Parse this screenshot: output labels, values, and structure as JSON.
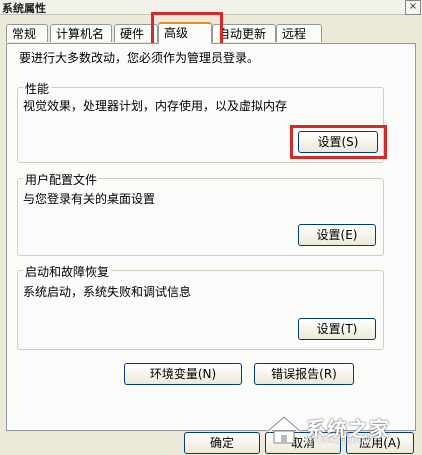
{
  "window": {
    "title": "系统属性",
    "close_glyph": "×"
  },
  "tabs": [
    {
      "label": "常规"
    },
    {
      "label": "计算机名"
    },
    {
      "label": "硬件"
    },
    {
      "label": "高级"
    },
    {
      "label": "自动更新"
    },
    {
      "label": "远程"
    }
  ],
  "notice": "要进行大多数改动，您必须作为管理员登录。",
  "performance": {
    "title": "性能",
    "desc": "视觉效果，处理器计划，内存使用，以及虚拟内存",
    "button": "设置(S)"
  },
  "profile": {
    "title": "用户配置文件",
    "desc": "与您登录有关的桌面设置",
    "button": "设置(E)"
  },
  "startup": {
    "title": "启动和故障恢复",
    "desc": "系统启动，系统失败和调试信息",
    "button": "设置(T)"
  },
  "bottom": {
    "env_button": "环境变量(N)",
    "error_button": "错误报告(R)"
  },
  "footer": {
    "ok": "确定",
    "cancel": "取消",
    "apply": "应用(A)"
  },
  "watermark": {
    "text": "系统之家",
    "url": "XITONGZHIJIA.NET"
  },
  "colors": {
    "highlight": "#d42a2a",
    "tab_active_top": "#e68b2c",
    "dialog_bg": "#ece9d8"
  }
}
